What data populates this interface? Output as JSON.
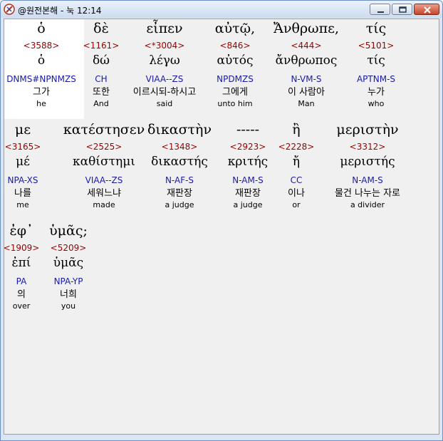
{
  "window": {
    "title": "@원전본해 - 눅 12:14"
  },
  "rows": [
    [
      {
        "greek": "ὁ",
        "strong": "<3588>",
        "lemma": "ὁ",
        "morph": "DNMS#NPNMZS",
        "korean": "그가",
        "english": "he"
      },
      {
        "greek": "δὲ",
        "strong": "<1161>",
        "lemma": "δώ",
        "morph": "CH",
        "korean": "또한",
        "english": "And"
      },
      {
        "greek": "εἶπεν",
        "strong": "<*3004>",
        "lemma": "λέγω",
        "morph": "VIAA--ZS",
        "korean": "이르시되-하시고",
        "english": "said"
      },
      {
        "greek": "αὐτῷ,",
        "strong": "<846>",
        "lemma": "αὐτός",
        "morph": "NPDMZS",
        "korean": "그에게",
        "english": "unto him"
      },
      {
        "greek": "Ἄνθρωπε,",
        "strong": "<444>",
        "lemma": "ἄνθρωπος",
        "morph": "N-VM-S",
        "korean": "이 사람아",
        "english": "Man"
      },
      {
        "greek": "τίς",
        "strong": "<5101>",
        "lemma": "τίς",
        "morph": "APTNM-S",
        "korean": "누가",
        "english": "who"
      }
    ],
    [
      {
        "greek": "με",
        "strong": "<3165>",
        "lemma": "μέ",
        "morph": "NPA-XS",
        "korean": "나를",
        "english": "me"
      },
      {
        "greek": "κατέστησεν",
        "strong": "<2525>",
        "lemma": "καθίστημι",
        "morph": "VIAA--ZS",
        "korean": "세워느냐",
        "english": "made"
      },
      {
        "greek": "δικαστὴν",
        "strong": "<1348>",
        "lemma": "δικαστής",
        "morph": "N-AF-S",
        "korean": "재판장",
        "english": "a judge"
      },
      {
        "greek": "-----",
        "strong": "<2923>",
        "lemma": "κριτής",
        "morph": "N-AM-S",
        "korean": "재판장",
        "english": "a judge"
      },
      {
        "greek": "ἢ",
        "strong": "<2228>",
        "lemma": "ἤ",
        "morph": "CC",
        "korean": "이나",
        "english": "or"
      },
      {
        "greek": "μεριστὴν",
        "strong": "<3312>",
        "lemma": "μεριστής",
        "morph": "N-AM-S",
        "korean": "물건 나누는 자로",
        "english": "a divider"
      }
    ],
    [
      {
        "greek": "ἐφ᾽",
        "strong": "<1909>",
        "lemma": "ἐπί",
        "morph": "PA",
        "korean": "의",
        "english": "over"
      },
      {
        "greek": "ὑμᾶς;",
        "strong": "<5209>",
        "lemma": "ὑμᾶς",
        "morph": "NPA-YP",
        "korean": "너희",
        "english": "you"
      }
    ]
  ]
}
